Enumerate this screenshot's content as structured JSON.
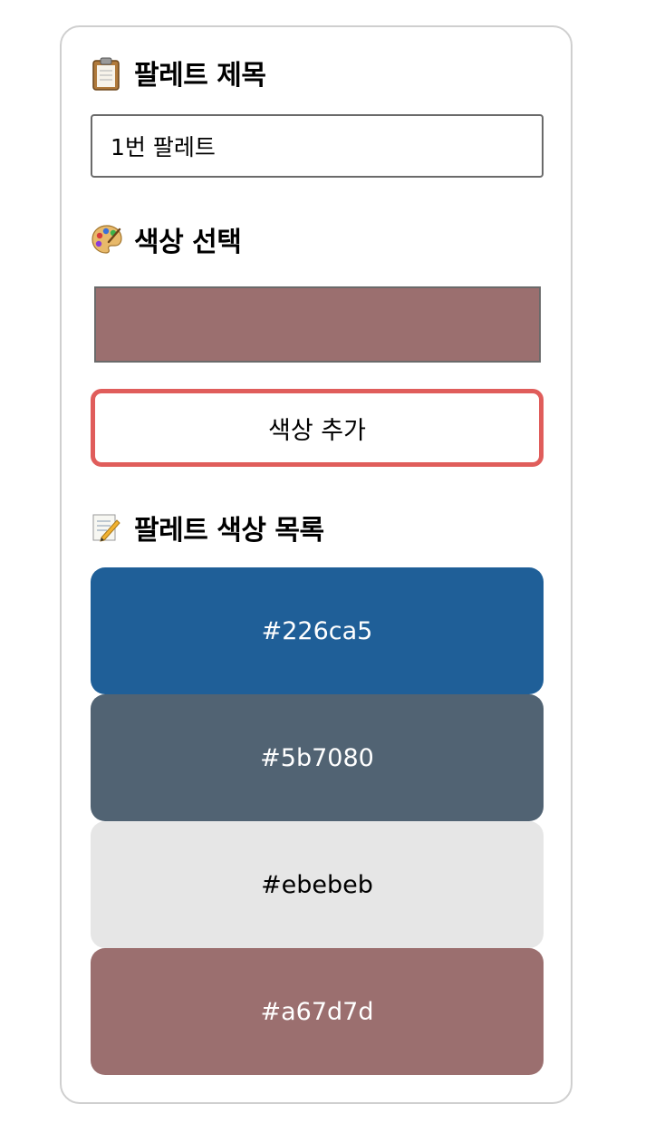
{
  "palette_title": {
    "heading": "팔레트 제목",
    "input_value": "1번 팔레트"
  },
  "color_select": {
    "heading": "색상 선택",
    "selected_color": "#9b6f6f"
  },
  "add_button": {
    "label": "색상 추가"
  },
  "color_list": {
    "heading": "팔레트 색상 목록",
    "items": [
      {
        "label": "#226ca5",
        "bg": "#1f5f98",
        "fg": "#ffffff"
      },
      {
        "label": "#5b7080",
        "bg": "#516373",
        "fg": "#ffffff"
      },
      {
        "label": "#ebebeb",
        "bg": "#e6e6e6",
        "fg": "#000000"
      },
      {
        "label": "#a67d7d",
        "bg": "#9b6f6f",
        "fg": "#ffffff"
      }
    ]
  },
  "icons": {
    "title_icon": "clipboard-icon",
    "color_select_icon": "palette-icon",
    "list_icon": "memo-icon"
  }
}
